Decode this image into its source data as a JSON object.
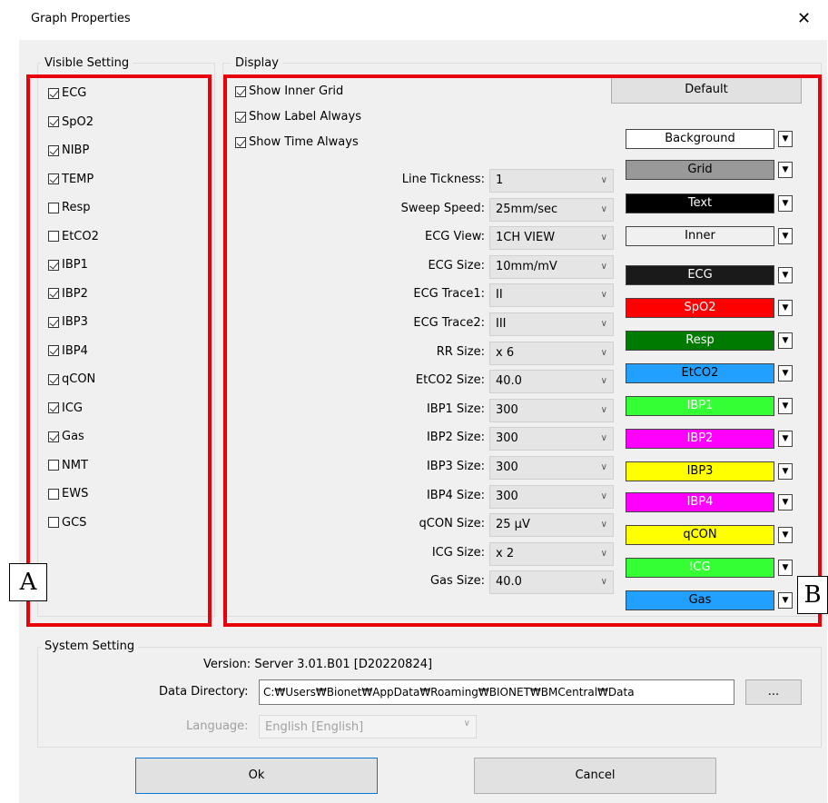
{
  "window": {
    "title": "Graph Properties",
    "close_glyph": "✕"
  },
  "visible_setting": {
    "label": "Visible Setting",
    "items": [
      {
        "label": "ECG",
        "checked": true
      },
      {
        "label": "SpO2",
        "checked": true
      },
      {
        "label": "NIBP",
        "checked": true
      },
      {
        "label": "TEMP",
        "checked": true
      },
      {
        "label": "Resp",
        "checked": false
      },
      {
        "label": "EtCO2",
        "checked": false
      },
      {
        "label": "IBP1",
        "checked": true
      },
      {
        "label": "IBP2",
        "checked": true
      },
      {
        "label": "IBP3",
        "checked": true
      },
      {
        "label": "IBP4",
        "checked": true
      },
      {
        "label": "qCON",
        "checked": true
      },
      {
        "label": "ICG",
        "checked": true
      },
      {
        "label": "Gas",
        "checked": true
      },
      {
        "label": "NMT",
        "checked": false
      },
      {
        "label": "EWS",
        "checked": false
      },
      {
        "label": "GCS",
        "checked": false
      }
    ]
  },
  "display": {
    "label": "Display",
    "checks": [
      {
        "label": "Show Inner Grid",
        "checked": true
      },
      {
        "label": "Show Label Always",
        "checked": true
      },
      {
        "label": "Show Time Always",
        "checked": true
      }
    ],
    "default_button": "Default",
    "settings": [
      {
        "label": "Line Tickness:",
        "value": "1"
      },
      {
        "label": "Sweep Speed:",
        "value": "25mm/sec"
      },
      {
        "label": "ECG View:",
        "value": "1CH VIEW"
      },
      {
        "label": "ECG Size:",
        "value": "10mm/mV"
      },
      {
        "label": "ECG Trace1:",
        "value": "II"
      },
      {
        "label": "ECG Trace2:",
        "value": "III"
      },
      {
        "label": "RR Size:",
        "value": "x 6"
      },
      {
        "label": "EtCO2 Size:",
        "value": "40.0"
      },
      {
        "label": "IBP1 Size:",
        "value": "300"
      },
      {
        "label": "IBP2 Size:",
        "value": "300"
      },
      {
        "label": "IBP3 Size:",
        "value": "300"
      },
      {
        "label": "IBP4 Size:",
        "value": "300"
      },
      {
        "label": "qCON Size:",
        "value": "25 µV"
      },
      {
        "label": "ICG Size:",
        "value": "x 2"
      },
      {
        "label": "Gas Size:",
        "value": "40.0"
      }
    ],
    "colors": [
      {
        "label": "Background",
        "bg": "#ffffff",
        "fg": "#000000"
      },
      {
        "label": "Grid",
        "bg": "#999999",
        "fg": "#000000"
      },
      {
        "label": "Text",
        "bg": "#000000",
        "fg": "#ffffff"
      },
      {
        "label": "Inner",
        "bg": "#f0f0f0",
        "fg": "#000000"
      },
      {
        "label": "ECG",
        "bg": "#1a1a1a",
        "fg": "#ffffff"
      },
      {
        "label": "SpO2",
        "bg": "#ff0000",
        "fg": "#ffffff"
      },
      {
        "label": "Resp",
        "bg": "#007a00",
        "fg": "#ffffff"
      },
      {
        "label": "EtCO2",
        "bg": "#22a0ff",
        "fg": "#000000"
      },
      {
        "label": "IBP1",
        "bg": "#33ff33",
        "fg": "#ffffff"
      },
      {
        "label": "IBP2",
        "bg": "#ff00ff",
        "fg": "#ffffff"
      },
      {
        "label": "IBP3",
        "bg": "#ffff00",
        "fg": "#000000"
      },
      {
        "label": "IBP4",
        "bg": "#ff00ff",
        "fg": "#ffffff"
      },
      {
        "label": "qCON",
        "bg": "#ffff00",
        "fg": "#000000"
      },
      {
        "label": "ICG",
        "bg": "#33ff33",
        "fg": "#ffffff"
      },
      {
        "label": "Gas",
        "bg": "#22a0ff",
        "fg": "#000000"
      }
    ]
  },
  "system_setting": {
    "label": "System Setting",
    "version": "Version: Server 3.01.B01 [D20220824]",
    "data_dir_label": "Data Directory:",
    "data_dir_value": "C:₩Users₩Bionet₩AppData₩Roaming₩BIONET₩BMCentral₩Data",
    "browse_label": "...",
    "language_label": "Language:",
    "language_value": "English [English]"
  },
  "buttons": {
    "ok": "Ok",
    "cancel": "Cancel"
  },
  "annotations": {
    "a": "A",
    "b": "B"
  },
  "theme": {
    "highlight": "#e8000b"
  }
}
